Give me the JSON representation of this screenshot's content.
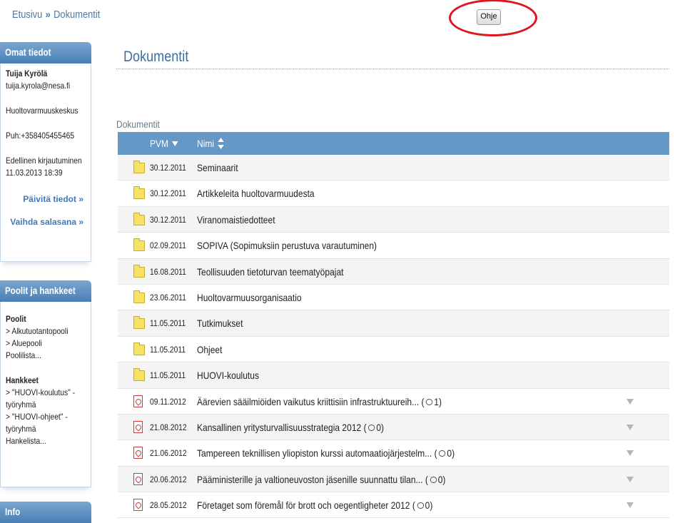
{
  "breadcrumb": {
    "home": "Etusivu",
    "separator": "»",
    "current": "Dokumentit"
  },
  "help_button": {
    "label": "Ohje"
  },
  "sidebar": {
    "user_box": {
      "title": "Omat tiedot",
      "name": "Tuija Kyrölä",
      "email": "tuija.kyrola@nesa.fi",
      "organization": "Huoltovarmuuskeskus",
      "phone": "Puh:+358405455465",
      "last_login_label": "Edellinen kirjautuminen",
      "last_login_value": "11.03.2013 18:39",
      "update_link": "Päivitä tiedot »",
      "password_link": "Vaihda salasana »"
    },
    "pools_box": {
      "title": "Poolit ja hankkeet",
      "pools_heading": "Poolit",
      "pools": [
        "> Alkutuotantopooli",
        "> Aluepooli"
      ],
      "pools_list_link": "Poolilista...",
      "projects_heading": "Hankkeet",
      "projects": [
        "> \"HUOVI-koulutus\" -",
        "työryhmä",
        "> \"HUOVI-ohjeet\" -",
        "työryhmä"
      ],
      "projects_list_link": "Hankelista..."
    },
    "info_box": {
      "title": "Info"
    }
  },
  "main": {
    "page_title": "Dokumentit",
    "section_label": "Dokumentit",
    "table": {
      "col_date": "PVM",
      "col_name": "Nimi",
      "rows": [
        {
          "type": "folder",
          "date": "30.12.2011",
          "name": "Seminaarit"
        },
        {
          "type": "folder",
          "date": "30.12.2011",
          "name": "Artikkeleita huoltovarmuudesta"
        },
        {
          "type": "folder",
          "date": "30.12.2011",
          "name": "Viranomaistiedotteet"
        },
        {
          "type": "folder",
          "date": "02.09.2011",
          "name": "SOPIVA (Sopimuksiin perustuva varautuminen)"
        },
        {
          "type": "folder",
          "date": "16.08.2011",
          "name": "Teollisuuden tietoturvan teematyöpajat"
        },
        {
          "type": "folder",
          "date": "23.06.2011",
          "name": "Huoltovarmuusorganisaatio"
        },
        {
          "type": "folder",
          "date": "11.05.2011",
          "name": "Tutkimukset"
        },
        {
          "type": "folder",
          "date": "11.05.2011",
          "name": "Ohjeet"
        },
        {
          "type": "folder",
          "date": "11.05.2011",
          "name": "HUOVI-koulutus"
        },
        {
          "type": "pdf",
          "date": "09.11.2012",
          "name": "Äärevien sääilmiöiden vaikutus kriittisiin infrastruktuureih...",
          "comments": "1"
        },
        {
          "type": "pdf",
          "date": "21.08.2012",
          "name": "Kansallinen yritysturvallisuusstrategia 2012",
          "comments": "0"
        },
        {
          "type": "pdf",
          "date": "21.06.2012",
          "name": "Tampereen teknillisen yliopiston kurssi automaatiojärjestelm...",
          "comments": "0"
        },
        {
          "type": "pdf",
          "date": "20.06.2012",
          "name": "Pääministerille ja valtioneuvoston jäsenille suunnattu tilan...",
          "comments": "0"
        },
        {
          "type": "pdf",
          "date": "28.05.2012",
          "name": "Företaget som föremål för brott och oegentligheter 2012",
          "comments": "0"
        }
      ]
    }
  }
}
